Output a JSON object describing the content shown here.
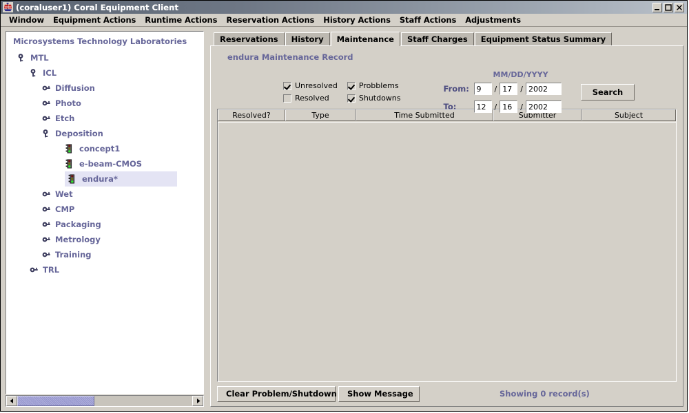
{
  "window": {
    "title": "(coraluser1) Coral Equipment Client",
    "icon": "coral-ship-icon",
    "controls": [
      {
        "name": "minimize-button",
        "glyph": "minimize"
      },
      {
        "name": "maximize-button",
        "glyph": "maximize"
      },
      {
        "name": "close-button",
        "glyph": "close"
      }
    ]
  },
  "menubar": {
    "items": [
      {
        "label": "Window"
      },
      {
        "label": "Equipment Actions"
      },
      {
        "label": "Runtime Actions"
      },
      {
        "label": "Reservation Actions"
      },
      {
        "label": "History Actions"
      },
      {
        "label": "Staff Actions"
      },
      {
        "label": "Adjustments"
      }
    ]
  },
  "tree": {
    "title": "Microsystems Technology Laboratories",
    "nodes": [
      {
        "label": "MTL",
        "depth": 0,
        "icon": "key-expanded-icon",
        "selected": false
      },
      {
        "label": "ICL",
        "depth": 1,
        "icon": "key-expanded-icon",
        "selected": false
      },
      {
        "label": "Diffusion",
        "depth": 2,
        "icon": "key-collapsed-icon",
        "selected": false
      },
      {
        "label": "Photo",
        "depth": 2,
        "icon": "key-collapsed-icon",
        "selected": false
      },
      {
        "label": "Etch",
        "depth": 2,
        "icon": "key-collapsed-icon",
        "selected": false
      },
      {
        "label": "Deposition",
        "depth": 2,
        "icon": "key-expanded-icon",
        "selected": false
      },
      {
        "label": "concept1",
        "depth": 3,
        "icon": "traffic-light-icon",
        "selected": false
      },
      {
        "label": "e-beam-CMOS",
        "depth": 3,
        "icon": "traffic-light-icon",
        "selected": false
      },
      {
        "label": "endura*",
        "depth": 3,
        "icon": "traffic-light-icon",
        "selected": true
      },
      {
        "label": "Wet",
        "depth": 2,
        "icon": "key-collapsed-icon",
        "selected": false
      },
      {
        "label": "CMP",
        "depth": 2,
        "icon": "key-collapsed-icon",
        "selected": false
      },
      {
        "label": "Packaging",
        "depth": 2,
        "icon": "key-collapsed-icon",
        "selected": false
      },
      {
        "label": "Metrology",
        "depth": 2,
        "icon": "key-collapsed-icon",
        "selected": false
      },
      {
        "label": "Training",
        "depth": 2,
        "icon": "key-collapsed-icon",
        "selected": false
      },
      {
        "label": "TRL",
        "depth": 1,
        "icon": "key-collapsed-icon",
        "selected": false
      }
    ],
    "scrollbar": {
      "left_arrow": "◀",
      "right_arrow": "▶"
    }
  },
  "tabs": [
    {
      "label": "Reservations",
      "active": false
    },
    {
      "label": "History",
      "active": false
    },
    {
      "label": "Maintenance",
      "active": true
    },
    {
      "label": "Staff Charges",
      "active": false
    },
    {
      "label": "Equipment Status Summary",
      "active": false
    }
  ],
  "maintenance": {
    "heading": "endura Maintenance Record",
    "filters": [
      {
        "label": "Unresolved",
        "checked": true
      },
      {
        "label": "Probblems",
        "checked": true
      },
      {
        "label": "Resolved",
        "checked": false
      },
      {
        "label": "Shutdowns",
        "checked": true
      }
    ],
    "date_format_hint": "MM/DD/YYYY",
    "from": {
      "label": "From:",
      "mm": "9",
      "dd": "17",
      "yyyy": "2002"
    },
    "to": {
      "label": "To:",
      "mm": "12",
      "dd": "16",
      "yyyy": "2002"
    },
    "search_label": "Search",
    "table": {
      "columns": [
        "Resolved?",
        "Type",
        "Time Submitted",
        "Submitter",
        "Subject"
      ],
      "rows": []
    },
    "clear_label": "Clear Problem/Shutdown",
    "show_message_label": "Show Message",
    "record_count": "Showing 0 record(s)"
  },
  "colors": {
    "face": "#d4d0c8",
    "accent_purple": "#666699",
    "title_bar_left": "#5a6472",
    "tab_inactive": "#bdb9b1",
    "selection": "#e4e4f4"
  }
}
